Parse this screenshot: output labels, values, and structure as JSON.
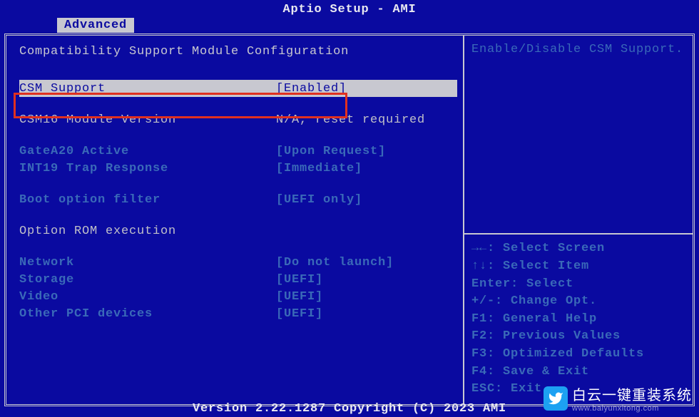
{
  "title": "Aptio Setup - AMI",
  "tab": "Advanced",
  "header": "Compatibility Support Module Configuration",
  "items": {
    "csm_support": {
      "label": "CSM Support",
      "value": "[Enabled]"
    },
    "csm16_version": {
      "label": "CSM16 Module Version",
      "value": "N/A, reset required"
    },
    "gatea20": {
      "label": "GateA20 Active",
      "value": "[Upon Request]"
    },
    "int19": {
      "label": "INT19 Trap Response",
      "value": "[Immediate]"
    },
    "boot_filter": {
      "label": "Boot option filter",
      "value": "[UEFI only]"
    },
    "rom_header": "Option ROM execution",
    "network": {
      "label": "Network",
      "value": "[Do not launch]"
    },
    "storage": {
      "label": "Storage",
      "value": "[UEFI]"
    },
    "video": {
      "label": "Video",
      "value": "[UEFI]"
    },
    "other_pci": {
      "label": "Other PCI devices",
      "value": "[UEFI]"
    }
  },
  "help_text": "Enable/Disable CSM Support.",
  "keys": {
    "k1": "→←: Select Screen",
    "k2": "↑↓: Select Item",
    "k3": "Enter: Select",
    "k4": "+/-: Change Opt.",
    "k5": "F1: General Help",
    "k6": "F2: Previous Values",
    "k7": "F3: Optimized Defaults",
    "k8": "F4: Save & Exit",
    "k9": "ESC: Exit"
  },
  "footer": "Version 2.22.1287 Copyright (C) 2023 AMI",
  "watermark": {
    "main": "白云一键重装系统",
    "sub": "www.baiyunxitong.com"
  }
}
